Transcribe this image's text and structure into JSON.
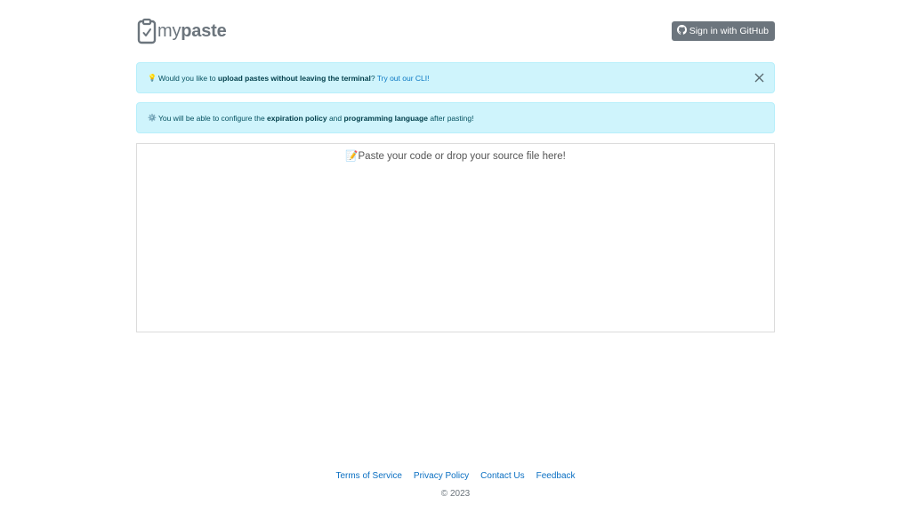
{
  "header": {
    "logo_light": "my",
    "logo_bold": "paste",
    "signin_label": "Sign in with GitHub"
  },
  "alerts": [
    {
      "emoji": "💡",
      "text_1": "Would you like to ",
      "bold_1": "upload pastes without leaving the terminal",
      "text_2": "? ",
      "link": "Try out our CLI!"
    },
    {
      "emoji": "⚙️",
      "text_1": "You will be able to configure the ",
      "bold_1": "expiration policy",
      "text_2": " and ",
      "bold_2": "programming language",
      "text_3": " after pasting!"
    }
  ],
  "paste": {
    "emoji": "📝",
    "placeholder": "Paste your code or drop your source file here!"
  },
  "footer": {
    "links": [
      "Terms of Service",
      "Privacy Policy",
      "Contact Us",
      "Feedback"
    ],
    "copyright": "© 2023"
  },
  "colors": {
    "alert_bg": "#cff4fc",
    "button_bg": "#6c757d",
    "link": "#0a6fc2"
  }
}
